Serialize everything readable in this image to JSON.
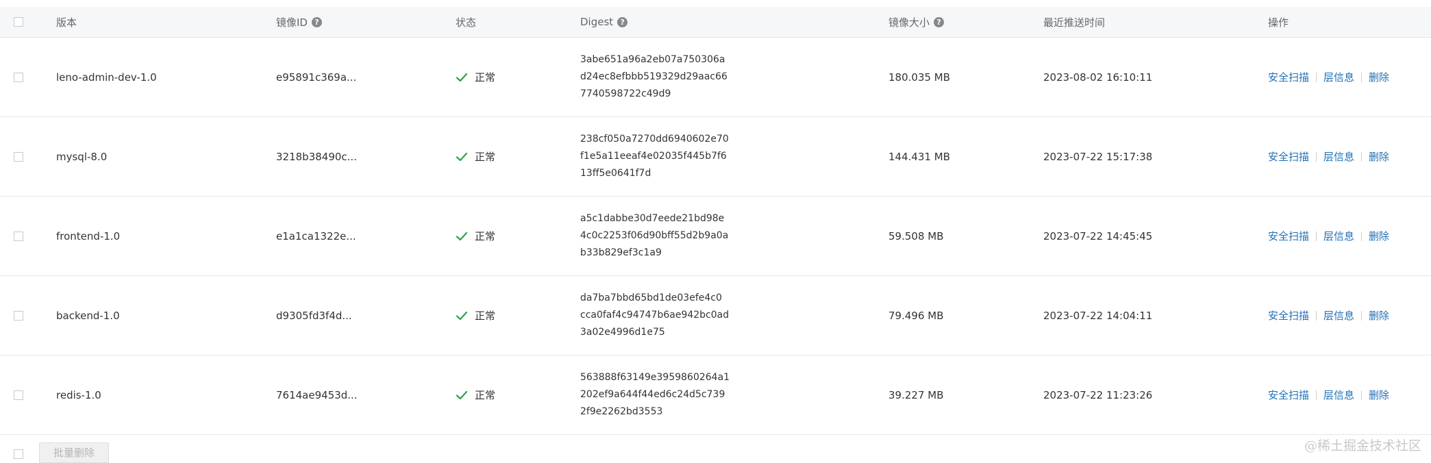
{
  "table": {
    "headers": {
      "version": "版本",
      "image_id": "镜像ID",
      "status": "状态",
      "digest": "Digest",
      "size": "镜像大小",
      "pushed_at": "最近推送时间",
      "actions": "操作"
    },
    "help_icon_glyph": "?",
    "rows": [
      {
        "version": "leno-admin-dev-1.0",
        "image_id": "e95891c369a...",
        "status": "正常",
        "digest": [
          "3abe651a96a2eb07a750306a",
          "d24ec8efbbb519329d29aac66",
          "7740598722c49d9"
        ],
        "size": "180.035 MB",
        "pushed_at": "2023-08-02 16:10:11"
      },
      {
        "version": "mysql-8.0",
        "image_id": "3218b38490c...",
        "status": "正常",
        "digest": [
          "238cf050a7270dd6940602e70",
          "f1e5a11eeaf4e02035f445b7f6",
          "13ff5e0641f7d"
        ],
        "size": "144.431 MB",
        "pushed_at": "2023-07-22 15:17:38"
      },
      {
        "version": "frontend-1.0",
        "image_id": "e1a1ca1322e...",
        "status": "正常",
        "digest": [
          "a5c1dabbe30d7eede21bd98e",
          "4c0c2253f06d90bff55d2b9a0a",
          "b33b829ef3c1a9"
        ],
        "size": "59.508 MB",
        "pushed_at": "2023-07-22 14:45:45"
      },
      {
        "version": "backend-1.0",
        "image_id": "d9305fd3f4d...",
        "status": "正常",
        "digest": [
          "da7ba7bbd65bd1de03efe4c0",
          "cca0faf4c94747b6ae942bc0ad",
          "3a02e4996d1e75"
        ],
        "size": "79.496 MB",
        "pushed_at": "2023-07-22 14:04:11"
      },
      {
        "version": "redis-1.0",
        "image_id": "7614ae9453d...",
        "status": "正常",
        "digest": [
          "563888f63149e3959860264a1",
          "202ef9a644f44ed6c24d5c739",
          "2f9e2262bd3553"
        ],
        "size": "39.227 MB",
        "pushed_at": "2023-07-22 11:23:26"
      }
    ],
    "actions": {
      "scan": "安全扫描",
      "layers": "层信息",
      "delete": "删除"
    }
  },
  "footer": {
    "batch_delete": "批量删除"
  },
  "watermark": "@稀土掘金技术社区",
  "colors": {
    "link": "#1f6fb5",
    "status_ok": "#2ba245",
    "header_bg": "#f6f7f9"
  },
  "icons": {
    "status_ok": "check-icon",
    "help": "help-circle-icon"
  }
}
